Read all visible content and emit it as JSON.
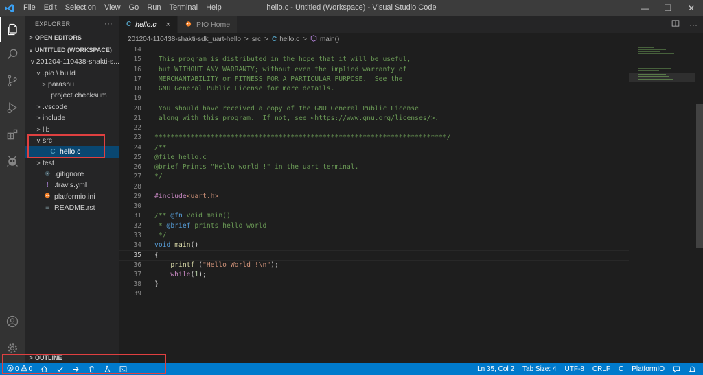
{
  "window": {
    "title": "hello.c - Untitled (Workspace) - Visual Studio Code",
    "menu": [
      "File",
      "Edit",
      "Selection",
      "View",
      "Go",
      "Run",
      "Terminal",
      "Help"
    ]
  },
  "sidebar": {
    "title": "EXPLORER",
    "more": "···",
    "open_editors": "OPEN EDITORS",
    "workspace": "UNTITLED (WORKSPACE)",
    "tree": [
      {
        "label": "201204-110438-shakti-s...",
        "indent": 1,
        "chevron": "v",
        "icon": ""
      },
      {
        "label": ".pio \\ build",
        "indent": 2,
        "chevron": "v",
        "icon": ""
      },
      {
        "label": "parashu",
        "indent": 3,
        "chevron": ">",
        "icon": ""
      },
      {
        "label": "project.checksum",
        "indent": 3,
        "chevron": "",
        "icon": ""
      },
      {
        "label": ".vscode",
        "indent": 2,
        "chevron": ">",
        "icon": ""
      },
      {
        "label": "include",
        "indent": 2,
        "chevron": ">",
        "icon": ""
      },
      {
        "label": "lib",
        "indent": 2,
        "chevron": ">",
        "icon": ""
      },
      {
        "label": "src",
        "indent": 2,
        "chevron": "v",
        "icon": ""
      },
      {
        "label": "hello.c",
        "indent": 3,
        "chevron": "",
        "icon": "C",
        "selected": true
      },
      {
        "label": "test",
        "indent": 2,
        "chevron": ">",
        "icon": ""
      },
      {
        "label": ".gitignore",
        "indent": 2,
        "chevron": "",
        "icon": "git"
      },
      {
        "label": ".travis.yml",
        "indent": 2,
        "chevron": "",
        "icon": "!"
      },
      {
        "label": "platformio.ini",
        "indent": 2,
        "chevron": "",
        "icon": "pio"
      },
      {
        "label": "README.rst",
        "indent": 2,
        "chevron": "",
        "icon": "lines"
      }
    ],
    "outline": "OUTLINE"
  },
  "tabs": [
    {
      "icon": "C",
      "label": "hello.c",
      "active": true,
      "close": "×"
    },
    {
      "icon": "pio",
      "label": "PIO Home",
      "active": false
    }
  ],
  "breadcrumb": [
    "201204-110438-shakti-sdk_uart-hello",
    "src",
    "hello.c",
    "main()"
  ],
  "editor": {
    "active_line": 35,
    "lines": [
      {
        "n": 14,
        "html": ""
      },
      {
        "n": 15,
        "html": "<span class='c-comment'> This program is distributed in the hope that it will be useful,</span>"
      },
      {
        "n": 16,
        "html": "<span class='c-comment'> but WITHOUT ANY WARRANTY; without even the implied warranty of</span>"
      },
      {
        "n": 17,
        "html": "<span class='c-comment'> MERCHANTABILITY or FITNESS FOR A PARTICULAR PURPOSE.  See the</span>"
      },
      {
        "n": 18,
        "html": "<span class='c-comment'> GNU General Public License for more details.</span>"
      },
      {
        "n": 19,
        "html": ""
      },
      {
        "n": 20,
        "html": "<span class='c-comment'> You should have received a copy of the GNU General Public License</span>"
      },
      {
        "n": 21,
        "html": "<span class='c-comment'> along with this program.  If not, see &lt;<span class='c-link'>https://www.gnu.org/licenses/</span>&gt;.</span>"
      },
      {
        "n": 22,
        "html": ""
      },
      {
        "n": 23,
        "html": "<span class='c-comment'>*************************************************************************/</span>"
      },
      {
        "n": 24,
        "html": "<span class='c-comment'>/**</span>"
      },
      {
        "n": 25,
        "html": "<span class='c-comment'>@file hello.c</span>"
      },
      {
        "n": 26,
        "html": "<span class='c-comment'>@brief Prints \"Hello world !\" in the uart terminal.</span>"
      },
      {
        "n": 27,
        "html": "<span class='c-comment'>*/</span>"
      },
      {
        "n": 28,
        "html": ""
      },
      {
        "n": 29,
        "html": "<span class='c-pp'>#include</span><span class='c-str'>&lt;uart.h&gt;</span>"
      },
      {
        "n": 30,
        "html": ""
      },
      {
        "n": 31,
        "html": "<span class='c-comment'>/** </span><span class='c-tag'>@fn</span><span class='c-comment'> void main()</span>"
      },
      {
        "n": 32,
        "html": "<span class='c-comment'> * </span><span class='c-tag'>@brief</span><span class='c-comment'> prints hello world</span>"
      },
      {
        "n": 33,
        "html": "<span class='c-comment'> */</span>"
      },
      {
        "n": 34,
        "html": "<span class='c-kw'>void</span> <span class='c-fn'>main</span>()"
      },
      {
        "n": 35,
        "html": "{"
      },
      {
        "n": 36,
        "html": "    <span class='c-fn'>printf</span> (<span class='c-str'>\"Hello World !\\n\"</span>);"
      },
      {
        "n": 37,
        "html": "    <span class='c-pp'>while</span>(<span class='c-num'>1</span>);"
      },
      {
        "n": 38,
        "html": "}"
      },
      {
        "n": 39,
        "html": ""
      }
    ]
  },
  "statusbar": {
    "errors": "0",
    "warnings": "0",
    "position": "Ln 35, Col 2",
    "tab_size": "Tab Size: 4",
    "encoding": "UTF-8",
    "eol": "CRLF",
    "language": "C",
    "platform": "PlatformIO"
  },
  "colors": {
    "accent": "#007acc",
    "annotation": "#e04040"
  }
}
